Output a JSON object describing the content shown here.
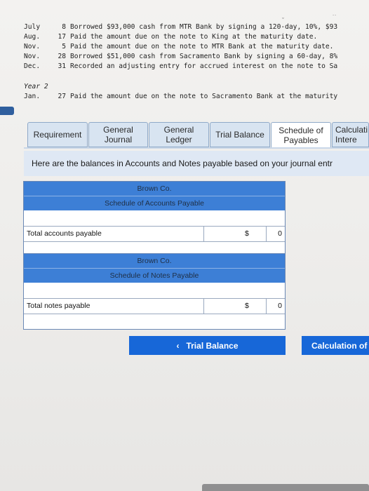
{
  "transactions": [
    {
      "month": "July",
      "day": "8",
      "text": "Borrowed $93,000 cash from MTR Bank by signing a 120-day, 10%, $93"
    },
    {
      "month": "Aug.",
      "day": "17",
      "text": "Paid the amount due on the note to King at the maturity date."
    },
    {
      "month": "Nov.",
      "day": "5",
      "text": "Paid the amount due on the note to MTR Bank at the maturity date."
    },
    {
      "month": "Nov.",
      "day": "28",
      "text": "Borrowed $51,000 cash from Sacramento Bank by signing a 60-day, 8%"
    },
    {
      "month": "Dec.",
      "day": "31",
      "text": "Recorded an adjusting entry for accrued interest on the note to Sa"
    }
  ],
  "year2": {
    "label": "Year 2",
    "month": "Jan.",
    "day": "27",
    "text": "Paid the amount due on the note to Sacramento Bank at the maturity"
  },
  "tabs": [
    {
      "label": "Requirement"
    },
    {
      "label": "General Journal"
    },
    {
      "label": "General Ledger"
    },
    {
      "label": "Trial Balance"
    },
    {
      "label": "Schedule of Payables"
    },
    {
      "label": "Calculati Intere"
    }
  ],
  "info_text": "Here are the balances in Accounts and Notes payable based on your journal entr",
  "accounts_schedule": {
    "company": "Brown Co.",
    "title": "Schedule of Accounts Payable",
    "total_label": "Total accounts payable",
    "currency": "$",
    "total_value": "0"
  },
  "notes_schedule": {
    "company": "Brown Co.",
    "title": "Schedule of Notes Payable",
    "total_label": "Total notes payable",
    "currency": "$",
    "total_value": "0"
  },
  "nav": {
    "prev_label": "Trial Balance",
    "next_label": "Calculation of"
  },
  "colors": {
    "accent": "#1767d8",
    "schedule_header": "#3d7fd6",
    "tab_bg": "#d8e4f1"
  }
}
